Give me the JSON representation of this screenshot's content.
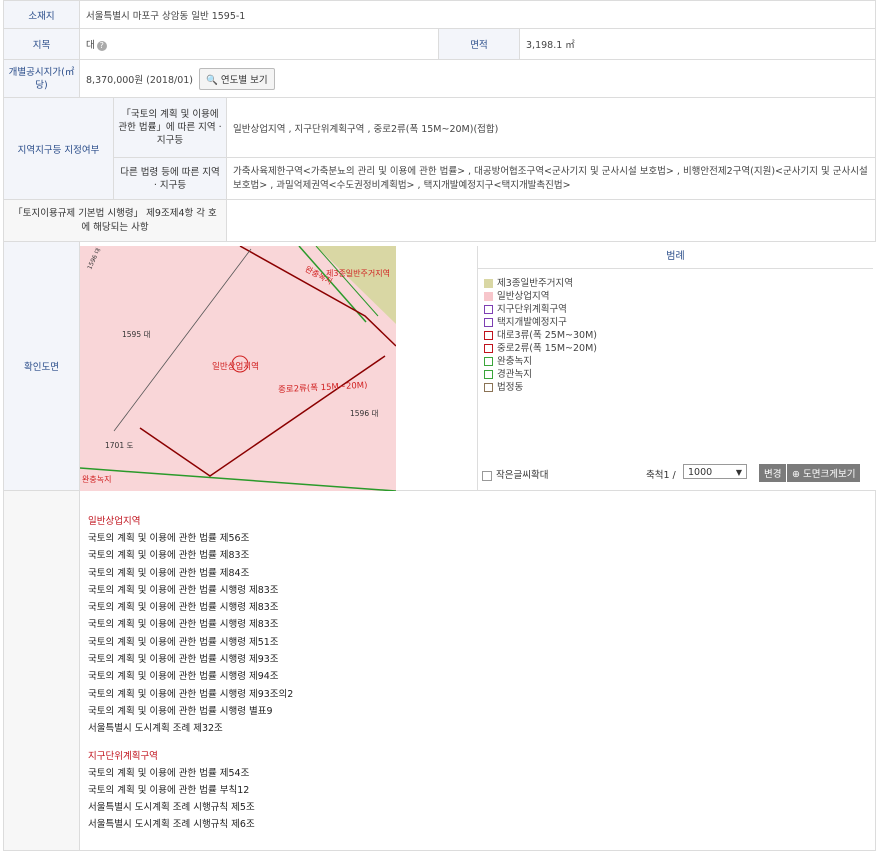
{
  "row_location": {
    "label": "소재지",
    "value": "서울특별시 마포구 상암동 일반 1595-1"
  },
  "row_land": {
    "label": "지목",
    "value": "대",
    "area_label": "면적",
    "area_value": "3,198.1 ㎡"
  },
  "row_price": {
    "label": "개별공시지가(㎡당)",
    "value": "8,370,000원 (2018/01)",
    "button": "연도별 보기"
  },
  "zoning": {
    "label": "지역지구등 지정여부",
    "national_label": "「국토의 계획 및 이용에 관한 법률」에 따른 지역 · 지구등",
    "national_value": "일반상업지역 , 지구단위계획구역 , 중로2류(폭 15M~20M)(접합)",
    "other_label": "다른 법령 등에 따른 지역 · 지구등",
    "other_value": "가축사육제한구역<가축분뇨의 관리 및 이용에 관한 법률> , 대공방어협조구역<군사기지 및 군사시설 보호법> , 비행안전제2구역(지원)<군사기지 및 군사시설 보호법> , 과밀억제권역<수도권정비계획법> , 택지개발예정지구<택지개발촉진법>"
  },
  "enforcement": {
    "label": "「토지이용규제 기본법 시행령」 제9조제4항 각 호에 해당되는 사항",
    "value": ""
  },
  "map_section": {
    "label": "확인도면",
    "map_labels": {
      "parcel_1595": "1595 대",
      "parcel_1596": "1596 대",
      "parcel_1701": "1701 도",
      "road_label": "중로2류(폭 15M~20M)",
      "zone_label": "일반상업지역",
      "top_label": "제3종일반주거지역",
      "green_label": "완충녹지",
      "bottom_left": "완충녹지",
      "tiny_top_left": "1596 대"
    },
    "legend_title": "범례",
    "legend": [
      {
        "label": "제3종일반주거지역",
        "color": "#d9d7a4",
        "outline": false
      },
      {
        "label": "일반상업지역",
        "color": "#f7c6cb",
        "outline": false
      },
      {
        "label": "지구단위계획구역",
        "color": "#7d3fb3",
        "outline": true
      },
      {
        "label": "택지개발예정지구",
        "color": "#7d3fb3",
        "outline": true
      },
      {
        "label": "대로3류(폭 25M~30M)",
        "color": "#c0121c",
        "outline": true
      },
      {
        "label": "중로2류(폭 15M~20M)",
        "color": "#c0121c",
        "outline": true
      },
      {
        "label": "완충녹지",
        "color": "#3aa53a",
        "outline": true
      },
      {
        "label": "경관녹지",
        "color": "#3aa53a",
        "outline": true
      },
      {
        "label": "법정동",
        "color": "#8b7355",
        "outline": true
      }
    ],
    "zoom_checkbox": "작은글씨확대",
    "scale_label": "축척1 /",
    "scale_value": "1000",
    "change_button": "변경",
    "enlarge_button": "도면크게보기"
  },
  "laws": [
    {
      "heading": "일반상업지역",
      "items": [
        "국토의 계획 및 이용에 관한 법률 제56조",
        "국토의 계획 및 이용에 관한 법률 제83조",
        "국토의 계획 및 이용에 관한 법률 제84조",
        "국토의 계획 및 이용에 관한 법률 시행령 제83조",
        "국토의 계획 및 이용에 관한 법률 시행령 제83조",
        "국토의 계획 및 이용에 관한 법률 시행령 제83조",
        "국토의 계획 및 이용에 관한 법률 시행령 제51조",
        "국토의 계획 및 이용에 관한 법률 시행령 제93조",
        "국토의 계획 및 이용에 관한 법률 시행령 제94조",
        "국토의 계획 및 이용에 관한 법률 시행령 제93조의2",
        "국토의 계획 및 이용에 관한 법률 시행령 별표9",
        "서울특별시 도시계획 조례 제32조"
      ]
    },
    {
      "heading": "지구단위계획구역",
      "items": [
        "국토의 계획 및 이용에 관한 법률 제54조",
        "국토의 계획 및 이용에 관한 법률 부칙12",
        "서울특별시 도시계획 조례 시행규칙 제5조",
        "서울특별시 도시계획 조례 시행규칙 제6조"
      ]
    }
  ]
}
